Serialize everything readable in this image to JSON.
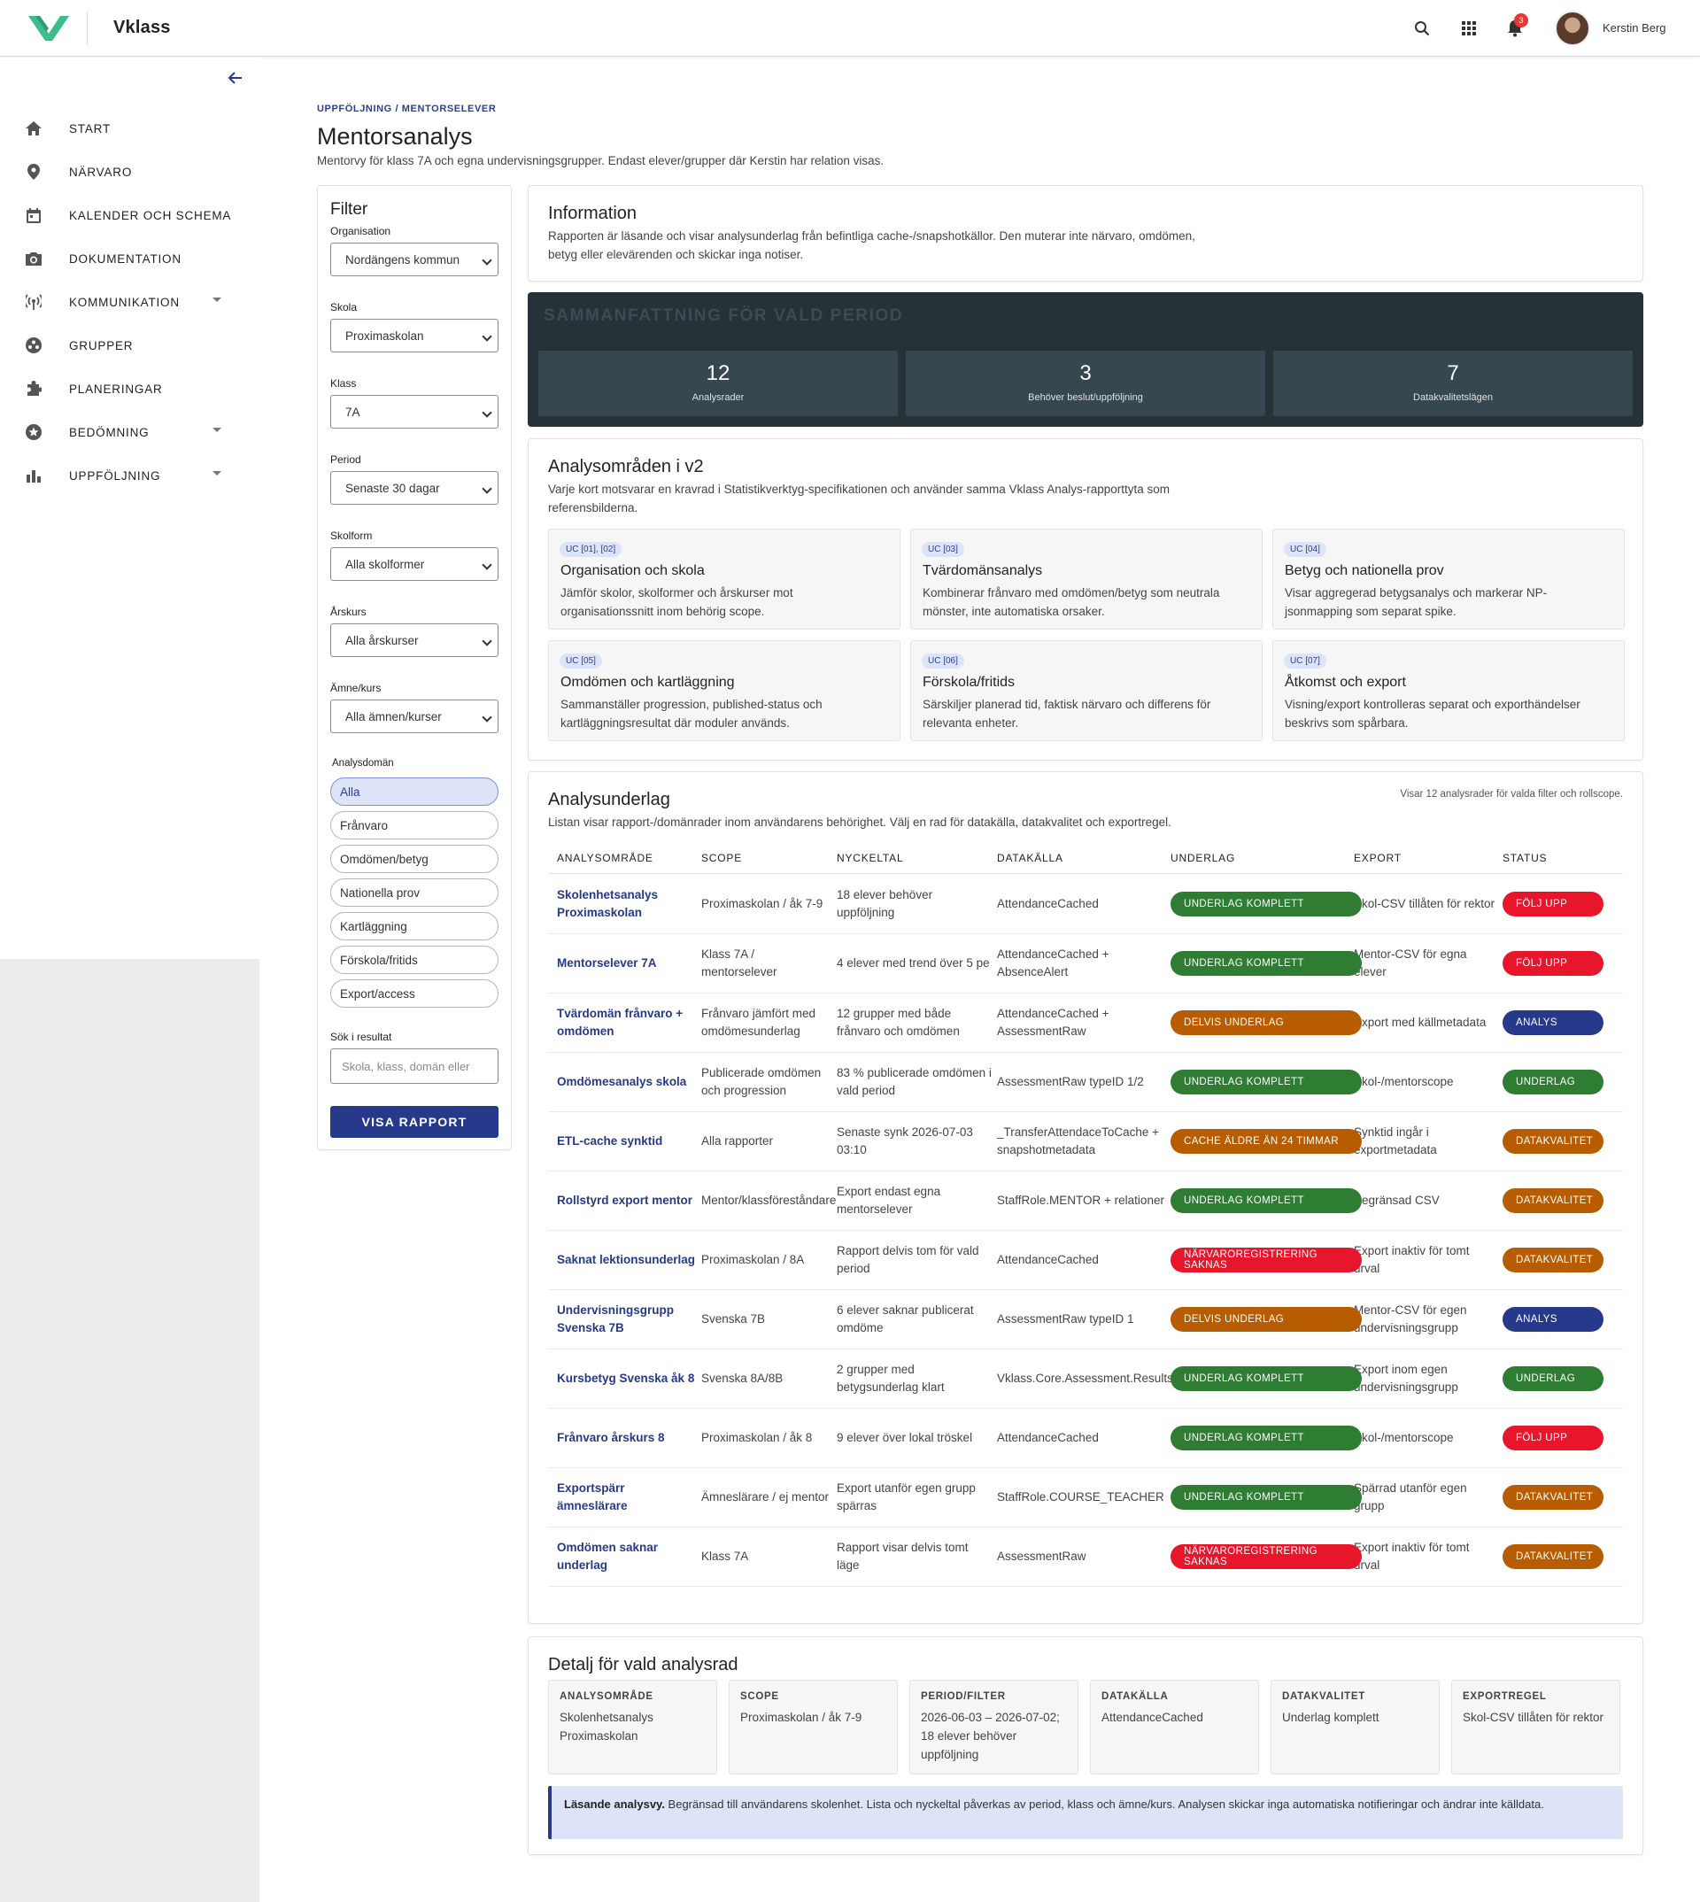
{
  "app": {
    "name": "Vklass",
    "user_name": "Kerstin Berg",
    "notif_count": "3"
  },
  "sidebar": {
    "items": [
      {
        "label": "START",
        "icon": "home-icon"
      },
      {
        "label": "NÄRVARO",
        "icon": "location-pin-icon"
      },
      {
        "label": "KALENDER OCH SCHEMA",
        "icon": "calendar-icon"
      },
      {
        "label": "DOKUMENTATION",
        "icon": "camera-icon"
      },
      {
        "label": "KOMMUNIKATION",
        "icon": "broadcast-icon"
      },
      {
        "label": "GRUPPER",
        "icon": "groups-icon"
      },
      {
        "label": "PLANERINGAR",
        "icon": "puzzle-icon"
      },
      {
        "label": "BEDÖMNING",
        "icon": "star-badge-icon"
      },
      {
        "label": "UPPFÖLJNING",
        "icon": "bar-chart-icon"
      }
    ]
  },
  "page": {
    "breadcrumb": "UPPFÖLJNING / MENTORSELEVER",
    "title": "Mentorsanalys",
    "subtitle": "Mentorvy för klass 7A och egna undervisningsgrupper. Endast elever/grupper där Kerstin har relation visas."
  },
  "filter": {
    "title": "Filter",
    "organisation_label": "Organisation",
    "organisation_value": "Nordängens kommun",
    "skola_label": "Skola",
    "skola_value": "Proximaskolan",
    "klass_label": "Klass",
    "klass_value": "7A",
    "period_label": "Period",
    "period_value": "Senaste 30 dagar",
    "skolform_label": "Skolform",
    "skolform_value": "Alla skolformer",
    "arskurs_label": "Årskurs",
    "arskurs_value": "Alla årskurser",
    "amne_label": "Ämne/kurs",
    "amne_value": "Alla ämnen/kurser",
    "domain_label": "Analysdomän",
    "domains": [
      "Alla",
      "Frånvaro",
      "Omdömen/betyg",
      "Nationella prov",
      "Kartläggning",
      "Förskola/fritids",
      "Export/access"
    ],
    "search_label": "Sök i resultat",
    "search_placeholder": "Skola, klass, domän eller",
    "button": "VISA RAPPORT"
  },
  "info": {
    "title": "Information",
    "text_line1": "Rapporten är läsande och visar analysunderlag från befintliga cache-/snapshotkällor. Den muterar inte närvaro, omdömen,",
    "text_line2": "betyg eller elevärenden och skickar inga notiser."
  },
  "summary": {
    "title": "SAMMANFATTNING FÖR VALD PERIOD",
    "kpis": [
      {
        "value": "12",
        "label": "Analysrader"
      },
      {
        "value": "3",
        "label": "Behöver beslut/uppföljning"
      },
      {
        "value": "7",
        "label": "Datakvalitetslägen"
      }
    ]
  },
  "areas": {
    "title": "Analysområden i v2",
    "text_line1": "Varje kort motsvarar en kravrad i Statistikverktyg-specifikationen och använder samma Vklass Analys-rapporttyta som",
    "text_line2": "referensbilderna.",
    "cards": [
      {
        "tag": "UC [01], [02]",
        "title": "Organisation och skola",
        "desc": "Jämför skolor, skolformer och årskurser mot organisationssnitt inom behörig scope."
      },
      {
        "tag": "UC [03]",
        "title": "Tvärdomänsanalys",
        "desc": "Kombinerar frånvaro med omdömen/betyg som neutrala mönster, inte automatiska orsaker."
      },
      {
        "tag": "UC [04]",
        "title": "Betyg och nationella prov",
        "desc": "Visar aggregerad betygsanalys och markerar NP-jsonmapping som separat spike."
      },
      {
        "tag": "UC [05]",
        "title": "Omdömen och kartläggning",
        "desc": "Sammanställer progression, published-status och kartläggningsresultat där moduler används."
      },
      {
        "tag": "UC [06]",
        "title": "Förskola/fritids",
        "desc": "Särskiljer planerad tid, faktisk närvaro och differens för relevanta enheter."
      },
      {
        "tag": "UC [07]",
        "title": "Åtkomst och export",
        "desc": "Visning/export kontrolleras separat och exporthändelser beskrivs som spårbara."
      }
    ]
  },
  "table": {
    "title": "Analysunderlag",
    "meta": "Visar 12 analysrader för valda filter och rollscope.",
    "text": "Listan visar rapport-/domänrader inom användarens behörighet. Välj en rad för datakälla, datakvalitet och exportregel.",
    "headers": [
      "ANALYSOMRÅDE",
      "SCOPE",
      "NYCKELTAL",
      "DATAKÄLLA",
      "UNDERLAG",
      "EXPORT",
      "STATUS"
    ],
    "rows": [
      {
        "area": "Skolenhetsanalys Proximaskolan",
        "scope": "Proximaskolan / åk 7-9",
        "key": "18 elever behöver uppföljning",
        "source": "AttendanceCached",
        "basis": "UNDERLAG KOMPLETT",
        "basis_color": "#2e7d32",
        "export": "Skol-CSV tillåten för rektor",
        "status": "FÖLJ UPP",
        "status_color": "#e8162b"
      },
      {
        "area": "Mentorselever 7A",
        "scope": "Klass 7A / mentorselever",
        "key": "4 elever med trend över 5 pe",
        "source": "AttendanceCached + AbsenceAlert",
        "basis": "UNDERLAG KOMPLETT",
        "basis_color": "#2e7d32",
        "export": "Mentor-CSV för egna elever",
        "status": "FÖLJ UPP",
        "status_color": "#e8162b"
      },
      {
        "area": "Tvärdomän frånvaro + omdömen",
        "scope": "Frånvaro jämfört med omdömesunderlag",
        "key": "12 grupper med både frånvaro och omdömen",
        "source": "AttendanceCached + AssessmentRaw",
        "basis": "DELVIS UNDERLAG",
        "basis_color": "#b85c00",
        "export": "Export med källmetadata",
        "status": "ANALYS",
        "status_color": "#27398a"
      },
      {
        "area": "Omdömesanalys skola",
        "scope": "Publicerade omdömen och progression",
        "key": "83 % publicerade omdömen i vald period",
        "source": "AssessmentRaw typeID 1/2",
        "basis": "UNDERLAG KOMPLETT",
        "basis_color": "#2e7d32",
        "export": "Skol-/mentorscope",
        "status": "UNDERLAG",
        "status_color": "#2e7d32"
      },
      {
        "area": "ETL-cache synktid",
        "scope": "Alla rapporter",
        "key": "Senaste synk 2026-07-03 03:10",
        "source": "_TransferAttendaceToCache + snapshotmetadata",
        "basis": "CACHE ÄLDRE ÄN 24 TIMMAR",
        "basis_color": "#b85c00",
        "export": "Synktid ingår i exportmetadata",
        "status": "DATAKVALITET",
        "status_color": "#b85c00"
      },
      {
        "area": "Rollstyrd export mentor",
        "scope": "Mentor/klassföreståndare",
        "key": "Export endast egna mentorselever",
        "source": "StaffRole.MENTOR + relationer",
        "basis": "UNDERLAG KOMPLETT",
        "basis_color": "#2e7d32",
        "export": "Begränsad CSV",
        "status": "DATAKVALITET",
        "status_color": "#b85c00"
      },
      {
        "area": "Saknat lektionsunderlag",
        "scope": "Proximaskolan / 8A",
        "key": "Rapport delvis tom för vald period",
        "source": "AttendanceCached",
        "basis": "NÄRVAROREGISTRERING SAKNAS",
        "basis_color": "#e8162b",
        "export": "Export inaktiv för tomt urval",
        "status": "DATAKVALITET",
        "status_color": "#b85c00"
      },
      {
        "area": "Undervisningsgrupp Svenska 7B",
        "scope": "Svenska 7B",
        "key": "6 elever saknar publicerat omdöme",
        "source": "AssessmentRaw typeID 1",
        "basis": "DELVIS UNDERLAG",
        "basis_color": "#b85c00",
        "export": "Mentor-CSV för egen undervisningsgrupp",
        "status": "ANALYS",
        "status_color": "#27398a"
      },
      {
        "area": "Kursbetyg Svenska åk 8",
        "scope": "Svenska 8A/8B",
        "key": "2 grupper med betygsunderlag klart",
        "source": "Vklass.Core.Assessment.Results",
        "basis": "UNDERLAG KOMPLETT",
        "basis_color": "#2e7d32",
        "export": "Export inom egen undervisningsgrupp",
        "status": "UNDERLAG",
        "status_color": "#2e7d32"
      },
      {
        "area": "Frånvaro årskurs 8",
        "scope": "Proximaskolan / åk 8",
        "key": "9 elever över lokal tröskel",
        "source": "AttendanceCached",
        "basis": "UNDERLAG KOMPLETT",
        "basis_color": "#2e7d32",
        "export": "Skol-/mentorscope",
        "status": "FÖLJ UPP",
        "status_color": "#e8162b"
      },
      {
        "area": "Exportspärr ämneslärare",
        "scope": "Ämneslärare / ej mentor",
        "key": "Export utanför egen grupp spärras",
        "source": "StaffRole.COURSE_TEACHER",
        "basis": "UNDERLAG KOMPLETT",
        "basis_color": "#2e7d32",
        "export": "Spärrad utanför egen grupp",
        "status": "DATAKVALITET",
        "status_color": "#b85c00"
      },
      {
        "area": "Omdömen saknar underlag",
        "scope": "Klass 7A",
        "key": "Rapport visar delvis tomt läge",
        "source": "AssessmentRaw",
        "basis": "NÄRVAROREGISTRERING SAKNAS",
        "basis_color": "#e8162b",
        "export": "Export inaktiv för tomt urval",
        "status": "DATAKVALITET",
        "status_color": "#b85c00"
      }
    ]
  },
  "detail": {
    "title": "Detalj för vald analysrad",
    "boxes": [
      {
        "key": "ANALYSOMRÅDE",
        "value": "Skolenhetsanalys Proximaskolan"
      },
      {
        "key": "SCOPE",
        "value": "Proximaskolan / åk 7-9"
      },
      {
        "key": "PERIOD/FILTER",
        "value": "2026-06-03 – 2026-07-02; 18 elever behöver uppföljning"
      },
      {
        "key": "DATAKÄLLA",
        "value": "AttendanceCached"
      },
      {
        "key": "DATAKVALITET",
        "value": "Underlag komplett"
      },
      {
        "key": "EXPORTREGEL",
        "value": "Skol-CSV tillåten för rektor"
      }
    ],
    "notice_bold": "Läsande analysvy.",
    "notice_text": " Begränsad till användarens skolenhet. Lista och nyckeltal påverkas av period, klass och ämne/kurs. Analysen skickar inga automatiska notifieringar och ändrar inte källdata."
  },
  "colors": {
    "brand": "#27398a",
    "logo": "#3bbd8c",
    "complete": "#2e7d32",
    "partial": "#b85c00",
    "alert": "#e8162b",
    "summary_bg": "#263238"
  }
}
